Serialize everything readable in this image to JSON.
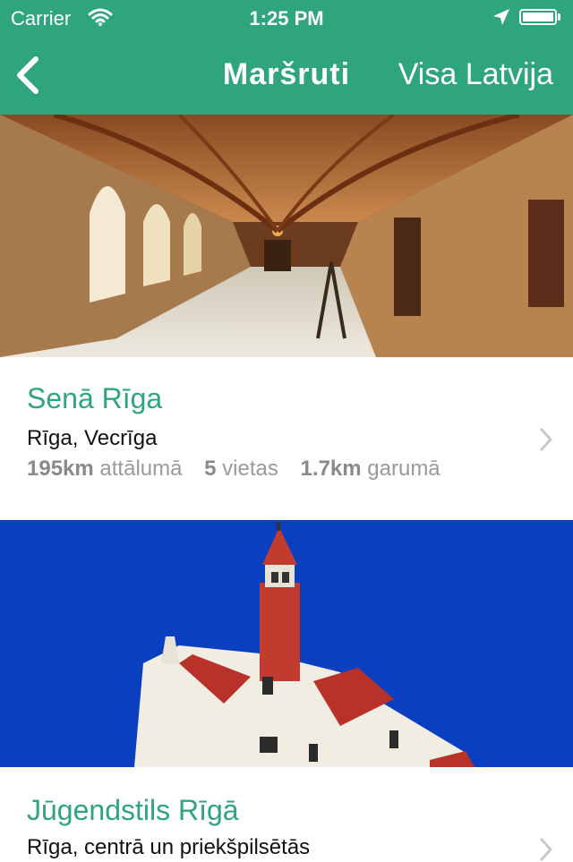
{
  "status_bar": {
    "carrier": "Carrier",
    "time": "1:25 PM",
    "wifi_icon": "wifi-icon",
    "location_icon": "location-arrow-icon",
    "battery_level": 1.0
  },
  "nav": {
    "back_icon": "chevron-left-icon",
    "title": "Maršruti",
    "right_label": "Visa Latvija"
  },
  "colors": {
    "accent": "#2fa57c",
    "secondary_text": "#9a9a9a"
  },
  "routes": [
    {
      "image": "monastery-cloister-corridor-photo",
      "title": "Senā Rīga",
      "subtitle": "Rīga, Vecrīga",
      "distance_value": "195km",
      "distance_label": "attālumā",
      "places_value": "5",
      "places_label": "vietas",
      "length_value": "1.7km",
      "length_label": "garumā"
    },
    {
      "image": "art-nouveau-building-photo",
      "title": "Jūgendstils Rīgā",
      "subtitle": "Rīga, centrā un priekšpilsētās"
    }
  ]
}
